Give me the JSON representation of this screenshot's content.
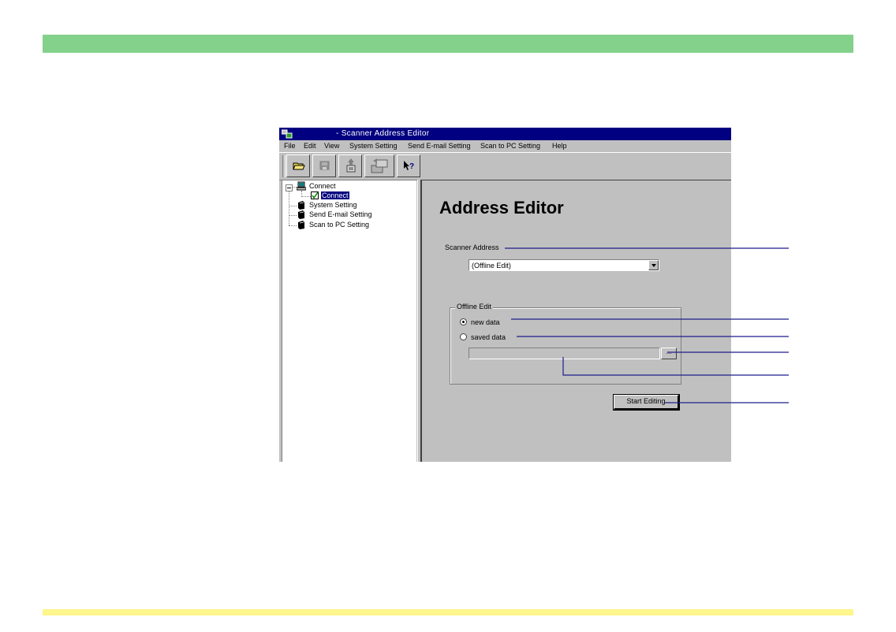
{
  "window": {
    "title": "- Scanner Address Editor",
    "menu": [
      "File",
      "Edit",
      "View",
      "System Setting",
      "Send E-mail Setting",
      "Scan to PC Setting",
      "Help"
    ],
    "toolbar": [
      "open-folder-icon",
      "save-disk-icon",
      "upload-icon",
      "transfer-icon",
      "help-pointer-icon"
    ]
  },
  "tree": {
    "root": "Connect",
    "child": "Connect",
    "items": [
      "System Setting",
      "Send E-mail Setting",
      "Scan to PC Setting"
    ]
  },
  "content": {
    "heading": "Address Editor",
    "scanner_address_label": "Scanner Address",
    "scanner_address_value": "(Offline Edit)",
    "offline_group_title": "Offline Edit",
    "radio_new": "new data",
    "radio_saved": "saved data",
    "selected_radio": "new data",
    "browse_label": "...",
    "start_button": "Start Editing"
  },
  "colors": {
    "top_band": "#84d18c",
    "bottom_band": "#fff68c",
    "titlebar": "#000080",
    "callout_line": "#1c1c8c"
  }
}
